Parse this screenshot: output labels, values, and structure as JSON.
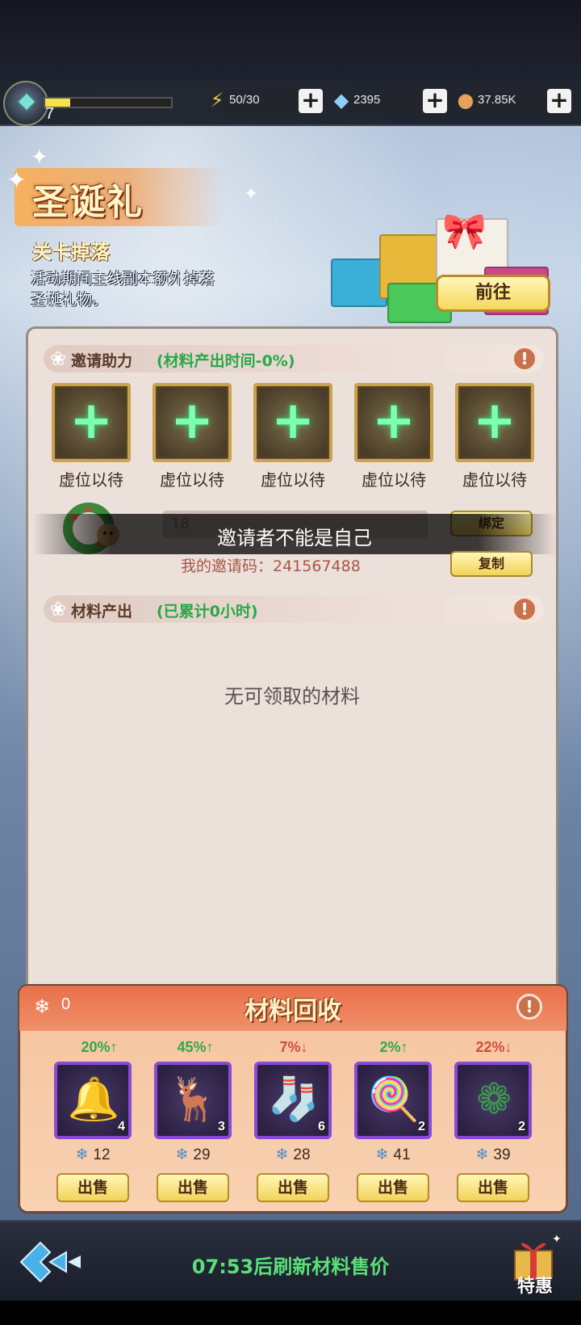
{
  "resources": {
    "level": "7",
    "xp_fraction": 0.2,
    "energy": "50/30",
    "diamond": "2395",
    "coin": "37.85K",
    "icons": [
      "energy-icon",
      "diamond-icon",
      "coin-icon"
    ]
  },
  "event": {
    "title": "圣诞礼",
    "subtitle": "关卡掉落",
    "description": "活动期间主线副本额外掉落圣诞礼物。",
    "go_button": "前往"
  },
  "invite": {
    "header": "邀请助力",
    "header_note": "(材料产出时间-0%)",
    "slots": [
      "虚位以待",
      "虚位以待",
      "虚位以待",
      "虚位以待",
      "虚位以待"
    ],
    "input_value": "18",
    "bind_button": "绑定",
    "my_code": "我的邀请码：241567488",
    "copy_button": "复制",
    "toast": "邀请者不能是自己"
  },
  "output": {
    "header": "材料产出",
    "header_note": "(已累计0小时)",
    "empty_message": "无可领取的材料"
  },
  "recycle": {
    "title": "材料回收",
    "snow_count": "0",
    "sell_label": "出售",
    "items": [
      {
        "name": "bell",
        "pct": "20%↑",
        "trend": "up",
        "count": "4",
        "price": "12"
      },
      {
        "name": "reindeer",
        "pct": "45%↑",
        "trend": "up",
        "count": "3",
        "price": "29"
      },
      {
        "name": "stocking",
        "pct": "7%↓",
        "trend": "down",
        "count": "6",
        "price": "28"
      },
      {
        "name": "candy-cane",
        "pct": "2%↑",
        "trend": "up",
        "count": "2",
        "price": "41"
      },
      {
        "name": "wreath",
        "pct": "22%↓",
        "trend": "down",
        "count": "2",
        "price": "39"
      }
    ]
  },
  "footer": {
    "refresh_text": "07:53后刷新材料售价",
    "special_offer": "特惠"
  }
}
